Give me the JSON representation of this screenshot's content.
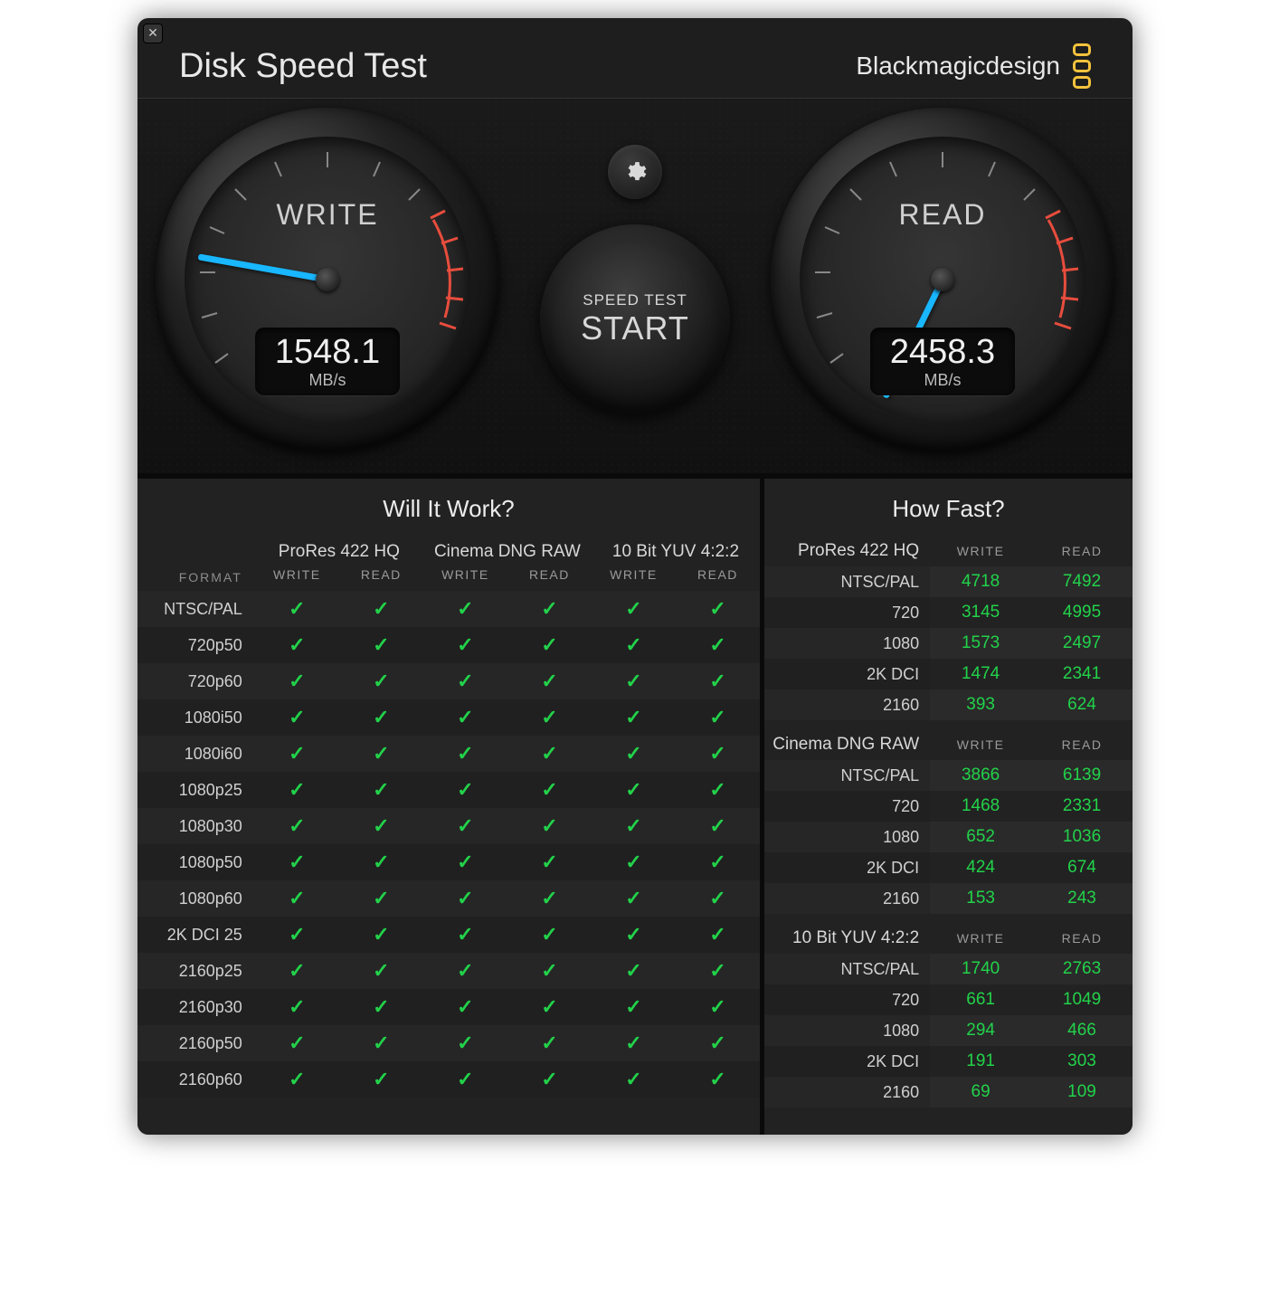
{
  "header": {
    "title": "Disk Speed Test",
    "brand": "Blackmagicdesign"
  },
  "gauges": {
    "write": {
      "label": "WRITE",
      "value": "1548.1",
      "unit": "MB/s",
      "angle": 10
    },
    "read": {
      "label": "READ",
      "value": "2458.3",
      "unit": "MB/s",
      "angle": -64
    }
  },
  "start": {
    "small": "SPEED TEST",
    "big": "START"
  },
  "will_it_work": {
    "title": "Will It Work?",
    "format_hdr": "FORMAT",
    "sub": {
      "write": "WRITE",
      "read": "READ"
    },
    "codecs": [
      "ProRes 422 HQ",
      "Cinema DNG RAW",
      "10 Bit YUV 4:2:2"
    ],
    "formats": [
      "NTSC/PAL",
      "720p50",
      "720p60",
      "1080i50",
      "1080i60",
      "1080p25",
      "1080p30",
      "1080p50",
      "1080p60",
      "2K DCI 25",
      "2160p25",
      "2160p30",
      "2160p50",
      "2160p60"
    ]
  },
  "how_fast": {
    "title": "How Fast?",
    "sub": {
      "write": "WRITE",
      "read": "READ"
    },
    "sections": [
      {
        "codec": "ProRes 422 HQ",
        "rows": [
          {
            "fmt": "NTSC/PAL",
            "write": "4718",
            "read": "7492"
          },
          {
            "fmt": "720",
            "write": "3145",
            "read": "4995"
          },
          {
            "fmt": "1080",
            "write": "1573",
            "read": "2497"
          },
          {
            "fmt": "2K DCI",
            "write": "1474",
            "read": "2341"
          },
          {
            "fmt": "2160",
            "write": "393",
            "read": "624"
          }
        ]
      },
      {
        "codec": "Cinema DNG RAW",
        "rows": [
          {
            "fmt": "NTSC/PAL",
            "write": "3866",
            "read": "6139"
          },
          {
            "fmt": "720",
            "write": "1468",
            "read": "2331"
          },
          {
            "fmt": "1080",
            "write": "652",
            "read": "1036"
          },
          {
            "fmt": "2K DCI",
            "write": "424",
            "read": "674"
          },
          {
            "fmt": "2160",
            "write": "153",
            "read": "243"
          }
        ]
      },
      {
        "codec": "10 Bit YUV 4:2:2",
        "rows": [
          {
            "fmt": "NTSC/PAL",
            "write": "1740",
            "read": "2763"
          },
          {
            "fmt": "720",
            "write": "661",
            "read": "1049"
          },
          {
            "fmt": "1080",
            "write": "294",
            "read": "466"
          },
          {
            "fmt": "2K DCI",
            "write": "191",
            "read": "303"
          },
          {
            "fmt": "2160",
            "write": "69",
            "read": "109"
          }
        ]
      }
    ]
  }
}
